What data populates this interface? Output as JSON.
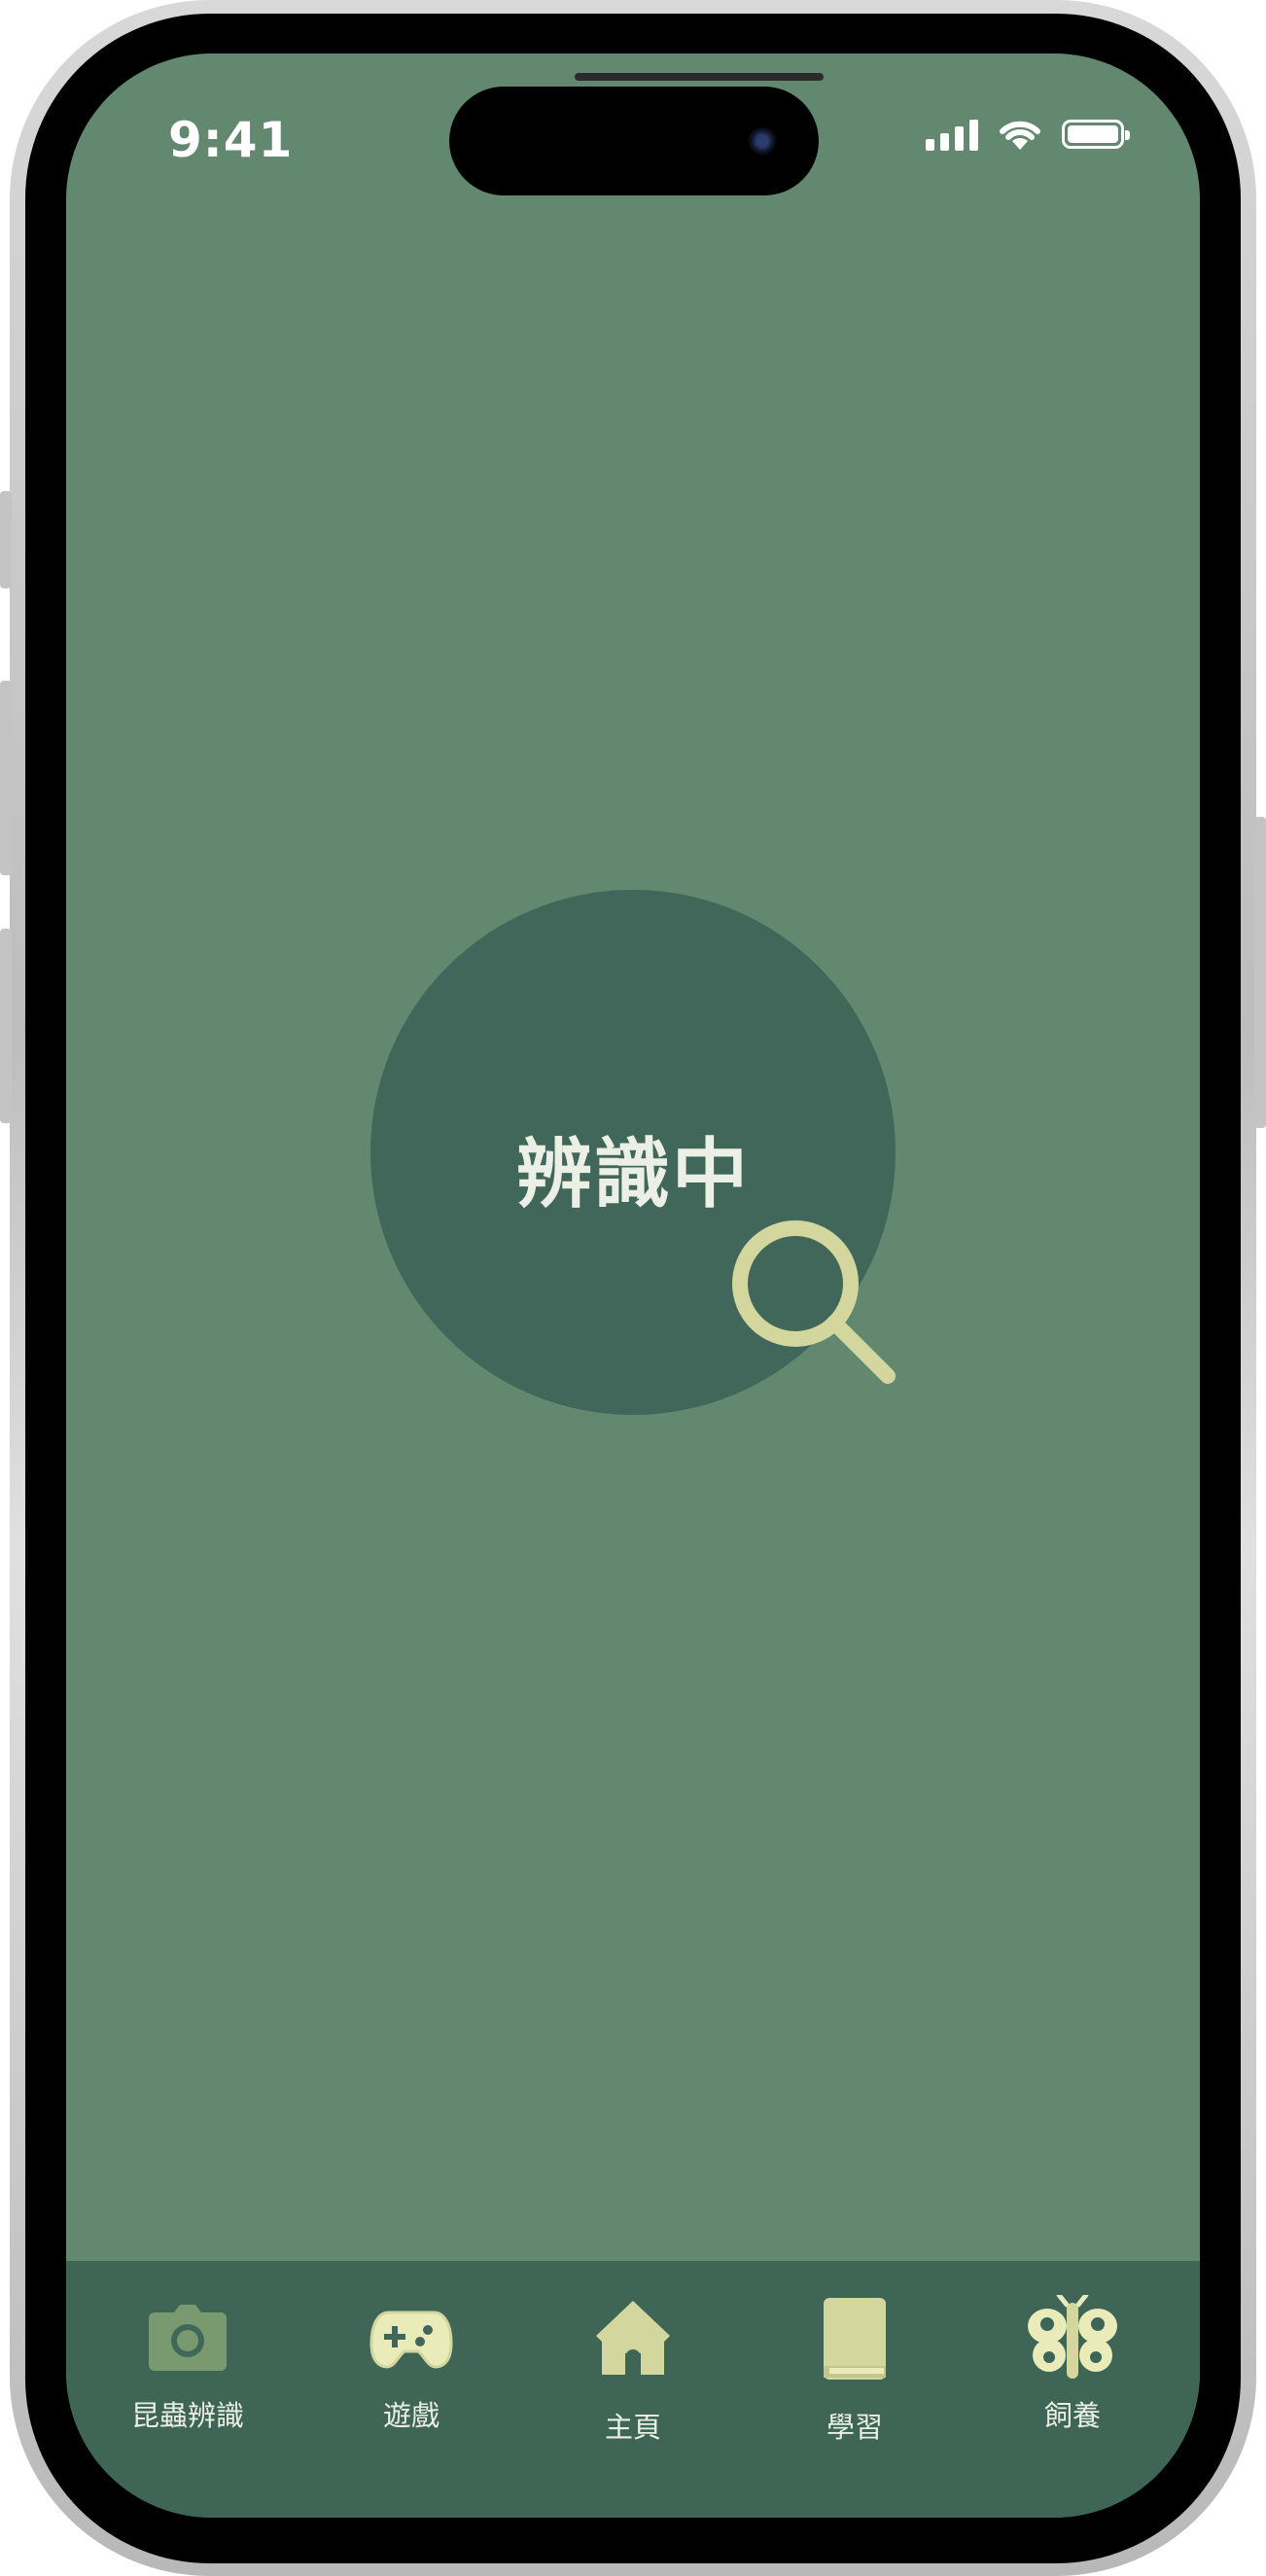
{
  "status_bar": {
    "time": "9:41"
  },
  "main": {
    "scan_label": "辨識中"
  },
  "tabbar": {
    "items": [
      {
        "label": "昆蟲辨識",
        "icon": "camera-icon"
      },
      {
        "label": "遊戲",
        "icon": "gamepad-icon"
      },
      {
        "label": "主頁",
        "icon": "home-icon"
      },
      {
        "label": "學習",
        "icon": "book-icon"
      },
      {
        "label": "飼養",
        "icon": "butterfly-icon"
      }
    ]
  },
  "colors": {
    "screen_bg": "#62886f",
    "circle_bg": "#40675a",
    "tabbar_bg": "#3e6556",
    "accent": "#d3d69d",
    "camera_icon": "#789a6e"
  }
}
